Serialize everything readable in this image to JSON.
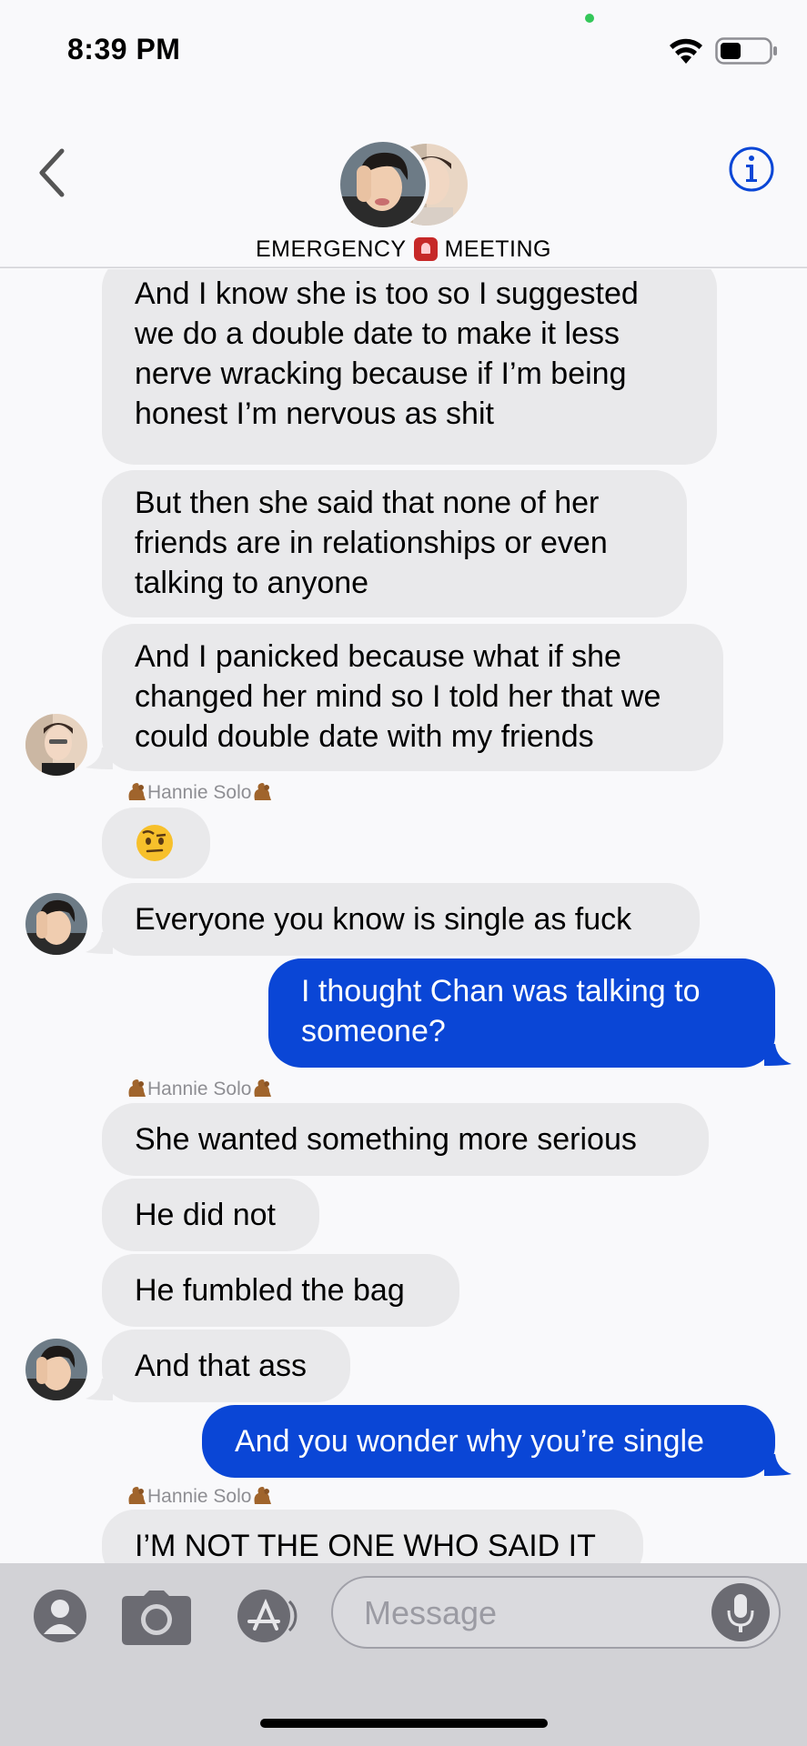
{
  "status_bar": {
    "time": "8:39 PM",
    "battery_icon": "battery-icon",
    "wifi_icon": "wifi-icon"
  },
  "header": {
    "title_part1": "EMERGENCY",
    "title_part2": "MEETING",
    "back_icon": "chevron-left-icon",
    "info_icon": "info-icon"
  },
  "messages": [
    {
      "dir": "in",
      "text": "And I know she is too so I suggested we do a double date to make it less nerve wracking because if I’m being honest I’m nervous as shit"
    },
    {
      "dir": "in",
      "text": "But then she said that none of her friends are in relationships or even talking to anyone"
    },
    {
      "dir": "in",
      "text": "And I panicked because what if she changed her mind so I told her that we could double date with my friends"
    },
    {
      "dir": "sender",
      "text": "Hannie Solo"
    },
    {
      "dir": "in",
      "text": "🤨"
    },
    {
      "dir": "in",
      "text": "Everyone you know is single as fuck"
    },
    {
      "dir": "out",
      "text": "I thought Chan was talking to someone?"
    },
    {
      "dir": "sender",
      "text": "Hannie Solo"
    },
    {
      "dir": "in",
      "text": "She wanted something more serious"
    },
    {
      "dir": "in",
      "text": "He did not"
    },
    {
      "dir": "in",
      "text": "He fumbled the bag"
    },
    {
      "dir": "in",
      "text": "And that ass"
    },
    {
      "dir": "out",
      "text": "And you wonder why you’re single"
    },
    {
      "dir": "sender",
      "text": "Hannie Solo"
    },
    {
      "dir": "in",
      "text": "I’M NOT THE ONE WHO SAID IT"
    }
  ],
  "input_bar": {
    "placeholder": "Message",
    "icons": [
      "memoji-icon",
      "camera-icon",
      "app-store-icon",
      "microphone-icon"
    ]
  },
  "colors": {
    "outgoing_bubble": "#0a46d6",
    "incoming_bubble": "#e9e9eb",
    "background": "#f9f9fb"
  }
}
